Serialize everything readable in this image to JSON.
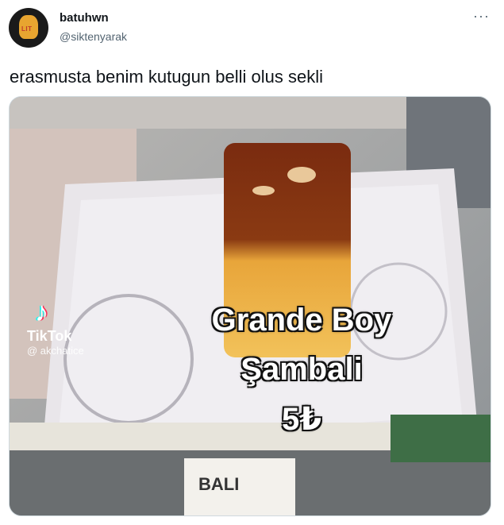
{
  "tweet": {
    "display_name": "batuhwn",
    "handle": "@siktenyarak",
    "text": "erasmusta benim kutugun belli olus sekli",
    "more_icon": "···"
  },
  "media": {
    "watermark_brand": "TikTok",
    "watermark_user": "@ akchatice",
    "caption_line1": "Grande Boy",
    "caption_line2": "Şambali",
    "caption_line3": "5₺",
    "sign_text": "BALI"
  },
  "avatar": {
    "tag_text": "LIT"
  }
}
